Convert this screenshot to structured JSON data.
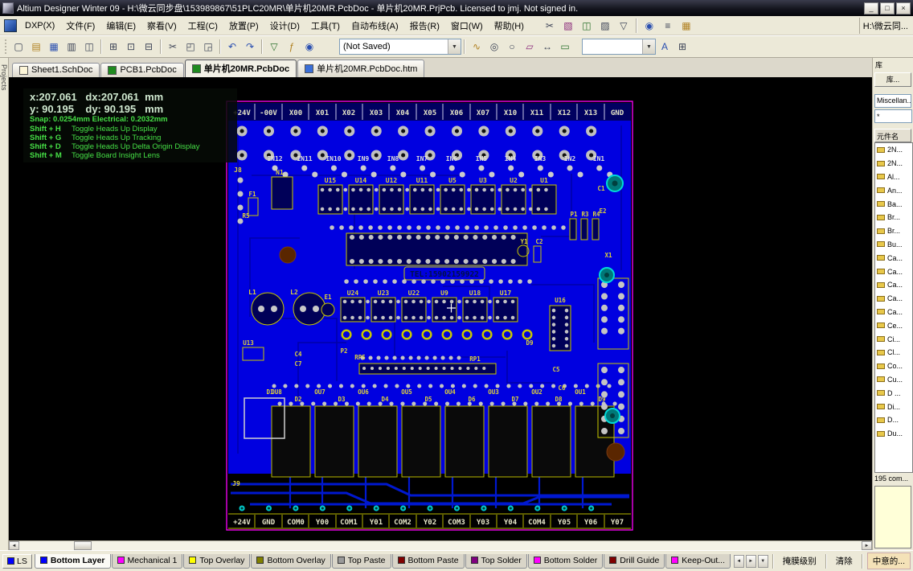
{
  "window": {
    "title": "Altium Designer Winter 09 - H:\\微云同步盘\\153989867\\51PLC20MR\\单片机20MR.PcbDoc - 单片机20MR.PrjPcb. Licensed to jmj. Not signed in."
  },
  "menubar": {
    "items": [
      "DXP(X)",
      "文件(F)",
      "编辑(E)",
      "察看(V)",
      "工程(C)",
      "放置(P)",
      "设计(D)",
      "工具(T)",
      "自动布线(A)",
      "报告(R)",
      "窗口(W)",
      "帮助(H)"
    ],
    "path_box": "H:\\微云同..."
  },
  "toolbar": {
    "not_saved": "(Not Saved)"
  },
  "doc_tabs": [
    {
      "label": "Sheet1.SchDoc"
    },
    {
      "label": "PCB1.PcbDoc"
    },
    {
      "label": "单片机20MR.PcbDoc"
    },
    {
      "label": "单片机20MR.PcbDoc.htm"
    }
  ],
  "left_rail": {
    "label": "Projects"
  },
  "hud": {
    "line_x": "x:207.061   dx:207.061  mm",
    "line_y": "y: 90.195    dy: 90.195   mm",
    "line_snap": "Snap: 0.0254mm Electrical: 0.2032mm",
    "shortcuts": [
      {
        "key": "Shift + H",
        "action": "Toggle Heads Up Display"
      },
      {
        "key": "Shift + G",
        "action": "Toggle Heads Up Tracking"
      },
      {
        "key": "Shift + D",
        "action": "Toggle Heads Up Delta Origin Display"
      },
      {
        "key": "Shift + M",
        "action": "Toggle Board Insight Lens"
      }
    ]
  },
  "library": {
    "panel_title": "库",
    "libraries_button": "库...",
    "library_name": "Miscellan...",
    "filter_value": "*",
    "list_header": "元件名",
    "components": [
      "2N...",
      "2N...",
      "Al...",
      "An...",
      "Ba...",
      "Br...",
      "Br...",
      "Bu...",
      "Ca...",
      "Ca...",
      "Ca...",
      "Ca...",
      "Ca...",
      "Ce...",
      "Ci...",
      "Cl...",
      "Co...",
      "Cu...",
      "D ...",
      "Di...",
      "D...",
      "Du..."
    ],
    "count_text": "195 com..."
  },
  "pcb": {
    "top_terminals": [
      "+24V",
      "-00V",
      "X00",
      "X01",
      "X02",
      "X03",
      "X04",
      "X05",
      "X06",
      "X07",
      "X10",
      "X11",
      "X12",
      "X13",
      "GND"
    ],
    "input_labels": [
      "IN12",
      "IN11",
      "IN10",
      "IN9",
      "IN8",
      "IN7",
      "IN6",
      "IN5",
      "IN4",
      "IN3",
      "IN2",
      "IN1"
    ],
    "ic_row1": [
      "U15",
      "U14",
      "U12",
      "U11",
      "U5",
      "U3",
      "U2",
      "U1"
    ],
    "ic_row2": [
      "U24",
      "U23",
      "U22",
      "U9",
      "U18",
      "U17"
    ],
    "tel_text": "TEL:15902159922",
    "output_labels": [
      "OU8",
      "OU7",
      "OU6",
      "OU5",
      "OU4",
      "OU3",
      "OU2",
      "OU1"
    ],
    "diode_labels": [
      "D2",
      "D3",
      "D4",
      "D5",
      "D6",
      "D7",
      "D8",
      "D9"
    ],
    "left_refs": [
      "J8",
      "N1",
      "F1",
      "R5",
      "L1",
      "L2",
      "E1",
      "U13",
      "D1",
      "J9"
    ],
    "right_refs": [
      "C1",
      "E2",
      "P1",
      "R3",
      "R4",
      "Y1",
      "C2",
      "X1",
      "U16",
      "C5",
      "C6",
      "D9"
    ],
    "misc_refs": [
      "P2",
      "RP5",
      "RP1",
      "C4",
      "C7"
    ],
    "bottom_terminals": [
      "+24V",
      "GND",
      "COM0",
      "Y00",
      "COM1",
      "Y01",
      "COM2",
      "Y02",
      "COM3",
      "Y03",
      "Y04",
      "COM4",
      "Y05",
      "Y06",
      "Y07"
    ]
  },
  "layer_bar": {
    "ls_label": "LS",
    "tabs": [
      {
        "label": "Bottom Layer",
        "color": "#0000ff"
      },
      {
        "label": "Mechanical 1",
        "color": "#ff00ff"
      },
      {
        "label": "Top Overlay",
        "color": "#ffff00"
      },
      {
        "label": "Bottom Overlay",
        "color": "#808000"
      },
      {
        "label": "Top Paste",
        "color": "#9a9a9a"
      },
      {
        "label": "Bottom Paste",
        "color": "#800000"
      },
      {
        "label": "Top Solder",
        "color": "#800080"
      },
      {
        "label": "Bottom Solder",
        "color": "#ff00ff"
      },
      {
        "label": "Drill Guide",
        "color": "#800000"
      },
      {
        "label": "Keep-Out...",
        "color": "#ff00ff"
      }
    ],
    "mask_level": "掩膜级别",
    "clear": "清除",
    "favorites": "中意的..."
  }
}
